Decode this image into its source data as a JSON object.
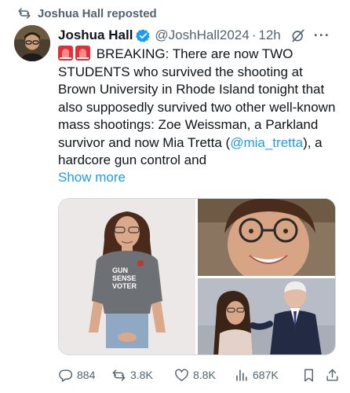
{
  "repost_banner": {
    "label": "Joshua Hall reposted",
    "icon": "repost-icon"
  },
  "author": {
    "name": "Joshua Hall",
    "handle": "@JoshHall2024",
    "separator": "·",
    "time": "12h",
    "verified_color": "#1d9bf0"
  },
  "tweet": {
    "text_part1": "BREAKING: There are now TWO STUDENTS who survived the shooting at Brown University in Rhode Island tonight that also supposedly survived two other well-known mass shootings: Zoe Weissman, a Parkland survivor and now Mia Tretta (",
    "mention": "@mia_tretta",
    "text_part2": "), a hardcore gun control and",
    "show_more": "Show more",
    "emoji": "siren-emoji"
  },
  "media": {
    "shirt_text_line1": "GUN",
    "shirt_text_line2": "SENSE",
    "shirt_text_line3": "VOTER"
  },
  "actions": {
    "replies": "884",
    "reposts": "3.8K",
    "likes": "8.8K",
    "views": "687K"
  },
  "colors": {
    "accent": "#1d9bf0",
    "muted": "#536471",
    "text": "#0f1419"
  }
}
